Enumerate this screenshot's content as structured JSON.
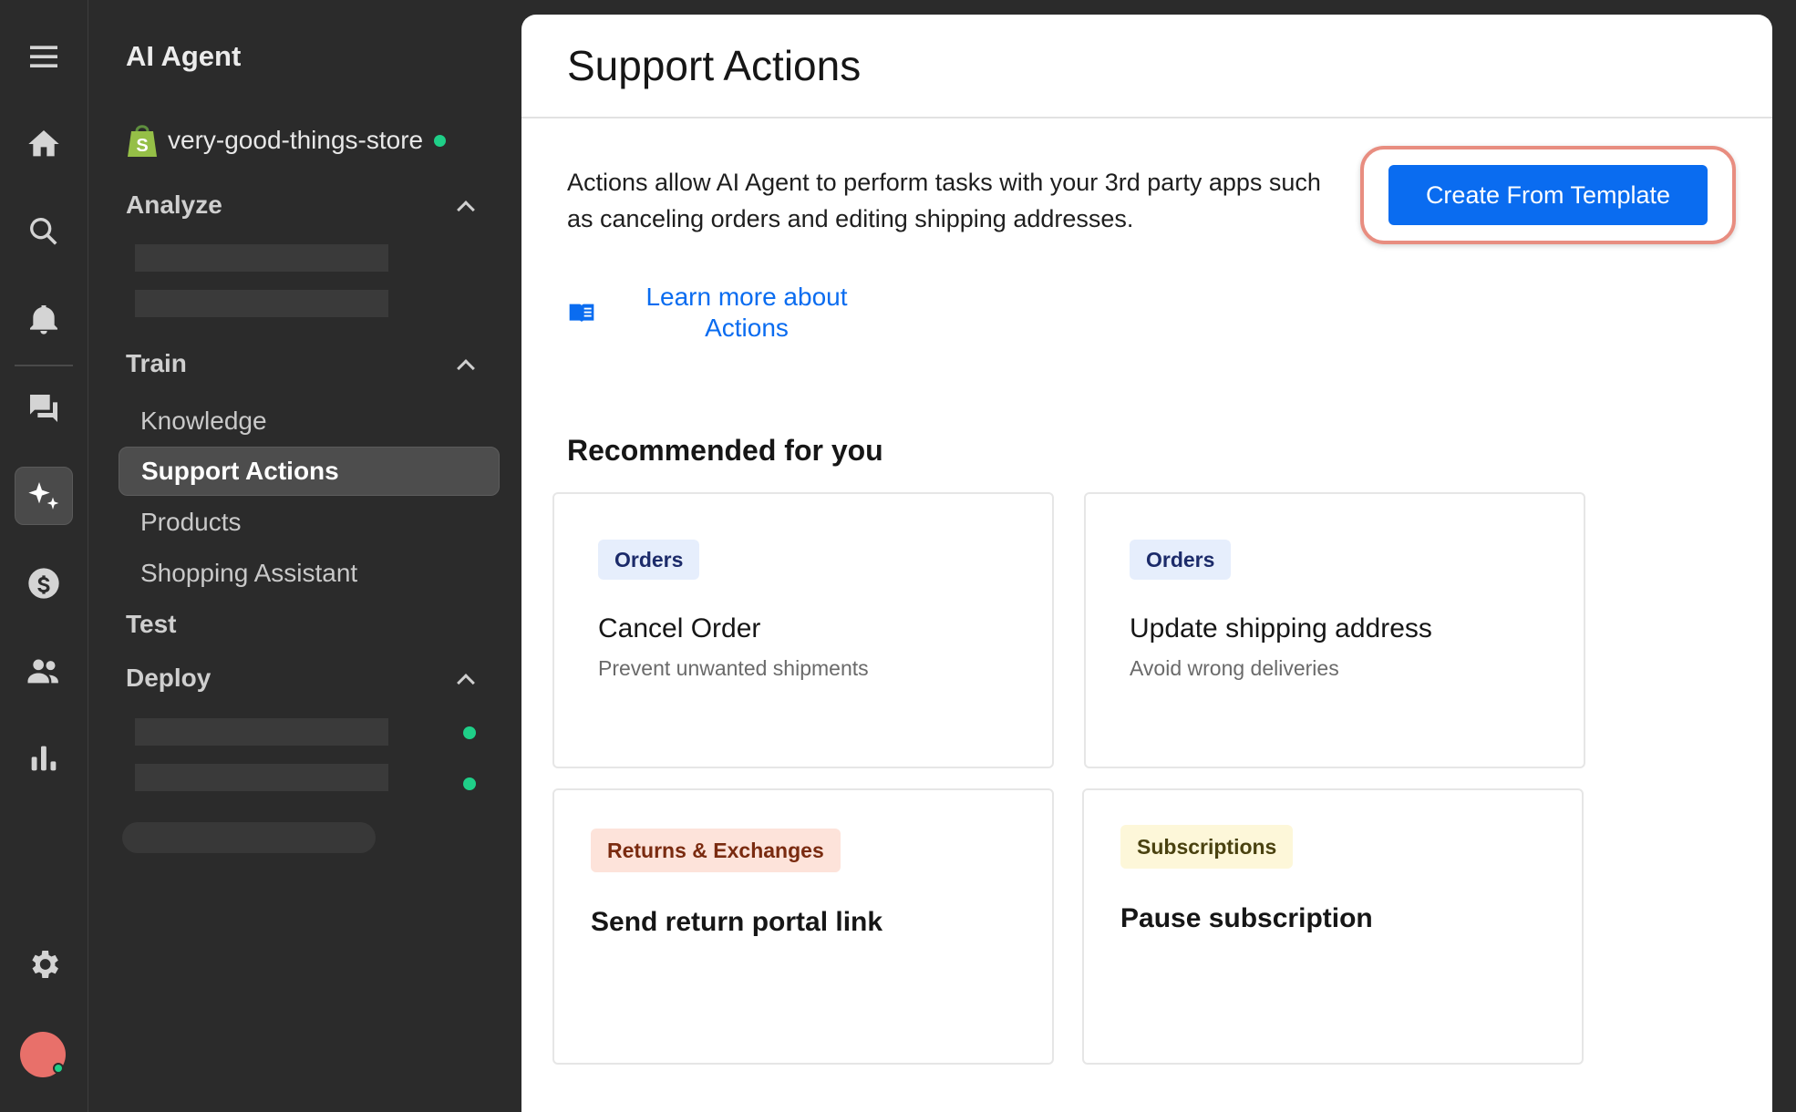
{
  "rail": {
    "icons": [
      "menu-icon",
      "home-icon",
      "search-icon",
      "bell-icon",
      "chat-icon",
      "sparkle-icon",
      "dollar-icon",
      "users-icon",
      "bar-chart-icon",
      "gear-icon"
    ],
    "active": "sparkle-icon"
  },
  "sidebar": {
    "title": "AI Agent",
    "store_name": "very-good-things-store",
    "sections": {
      "analyze": "Analyze",
      "train": "Train",
      "test": "Test",
      "deploy": "Deploy"
    },
    "train_items": [
      "Knowledge",
      "Support Actions",
      "Products",
      "Shopping Assistant"
    ],
    "active_item": "Support Actions"
  },
  "main": {
    "title": "Support Actions",
    "description": "Actions allow AI Agent to perform tasks with your 3rd party apps such as canceling orders and editing shipping addresses.",
    "cta_label": "Create From Template",
    "learn_more": "Learn more about Actions",
    "recommended_title": "Recommended for you",
    "cards": [
      {
        "tag": "Orders",
        "title": "Cancel Order",
        "subtitle": "Prevent unwanted shipments"
      },
      {
        "tag": "Orders",
        "title": "Update shipping address",
        "subtitle": "Avoid wrong deliveries"
      },
      {
        "tag": "Returns & Exchanges",
        "title": "Send return portal link",
        "subtitle": ""
      },
      {
        "tag": "Subscriptions",
        "title": "Pause subscription",
        "subtitle": ""
      }
    ]
  },
  "colors": {
    "accent": "#0a6cf0",
    "highlight_ring": "#e88d80",
    "status_green": "#1fcf88"
  }
}
